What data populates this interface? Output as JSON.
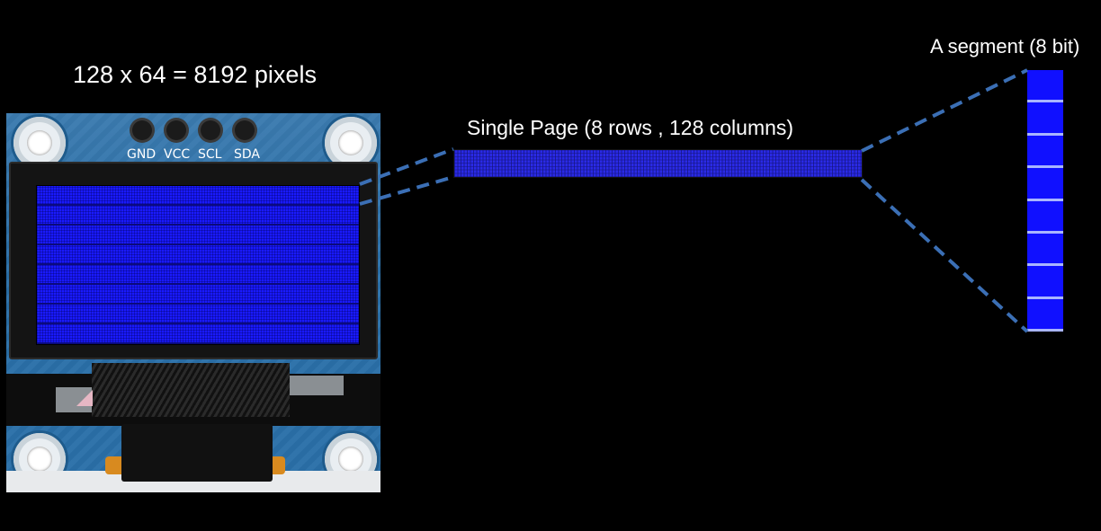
{
  "labels": {
    "total_pixels": "128 x 64 = 8192 pixels",
    "single_page": "Single Page (8 rows , 128 columns)",
    "segment": "A segment (8 bit)"
  },
  "module": {
    "pins": [
      "GND",
      "VCC",
      "SCL",
      "SDA"
    ]
  },
  "segment_bits": 8,
  "colors": {
    "background": "#000000",
    "pixel_blue": "#1a1aff",
    "connector": "#3b6fb5",
    "pcb_blue": "#2a6fa8"
  }
}
